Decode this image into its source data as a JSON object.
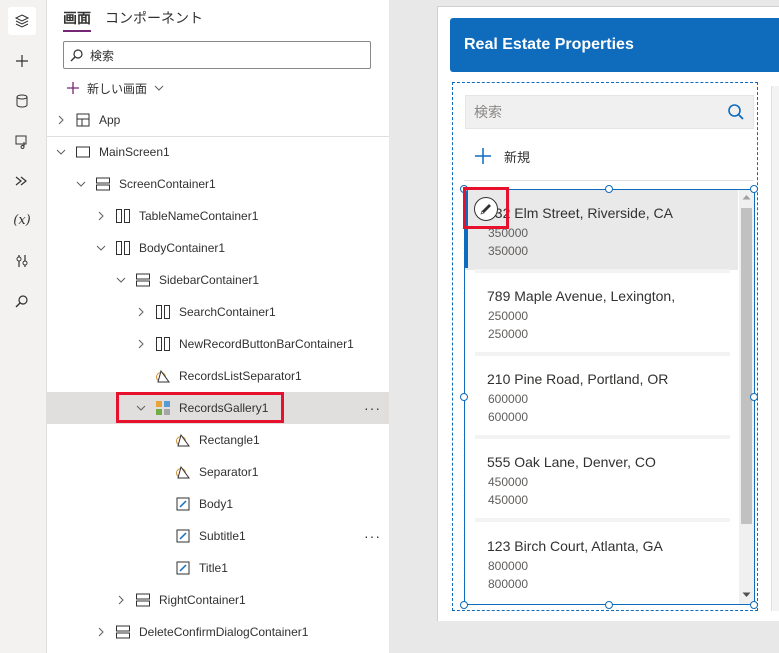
{
  "tabs": [
    {
      "label": "画面",
      "active": true
    },
    {
      "label": "コンポーネント",
      "active": false
    }
  ],
  "search": {
    "placeholder": "検索"
  },
  "new_screen": {
    "label": "新しい画面"
  },
  "tree": {
    "app": "App",
    "main_screen": "MainScreen1",
    "screen_container": "ScreenContainer1",
    "table_name_container": "TableNameContainer1",
    "body_container": "BodyContainer1",
    "sidebar_container": "SidebarContainer1",
    "search_container": "SearchContainer1",
    "new_record_bar": "NewRecordButtonBarContainer1",
    "records_list_separator": "RecordsListSeparator1",
    "records_gallery": "RecordsGallery1",
    "rectangle": "Rectangle1",
    "separator": "Separator1",
    "body": "Body1",
    "subtitle": "Subtitle1",
    "title": "Title1",
    "right_container": "RightContainer1",
    "delete_dialog": "DeleteConfirmDialogContainer1",
    "more": "···"
  },
  "canvas": {
    "header_title": "Real Estate Properties",
    "search_placeholder": "検索",
    "new_label": "新規",
    "records": [
      {
        "title": "432 Elm Street, Riverside, CA",
        "subtitle": "350000",
        "body": "350000"
      },
      {
        "title": "789 Maple Avenue, Lexington,",
        "subtitle": "250000",
        "body": "250000"
      },
      {
        "title": "210 Pine Road, Portland, OR",
        "subtitle": "600000",
        "body": "600000"
      },
      {
        "title": "555 Oak Lane, Denver, CO",
        "subtitle": "450000",
        "body": "450000"
      },
      {
        "title": "123 Birch Court, Atlanta, GA",
        "subtitle": "800000",
        "body": "800000"
      }
    ]
  },
  "colors": {
    "accent": "#0f6cbd",
    "highlight": "#e8112d",
    "purple": "#742774"
  }
}
